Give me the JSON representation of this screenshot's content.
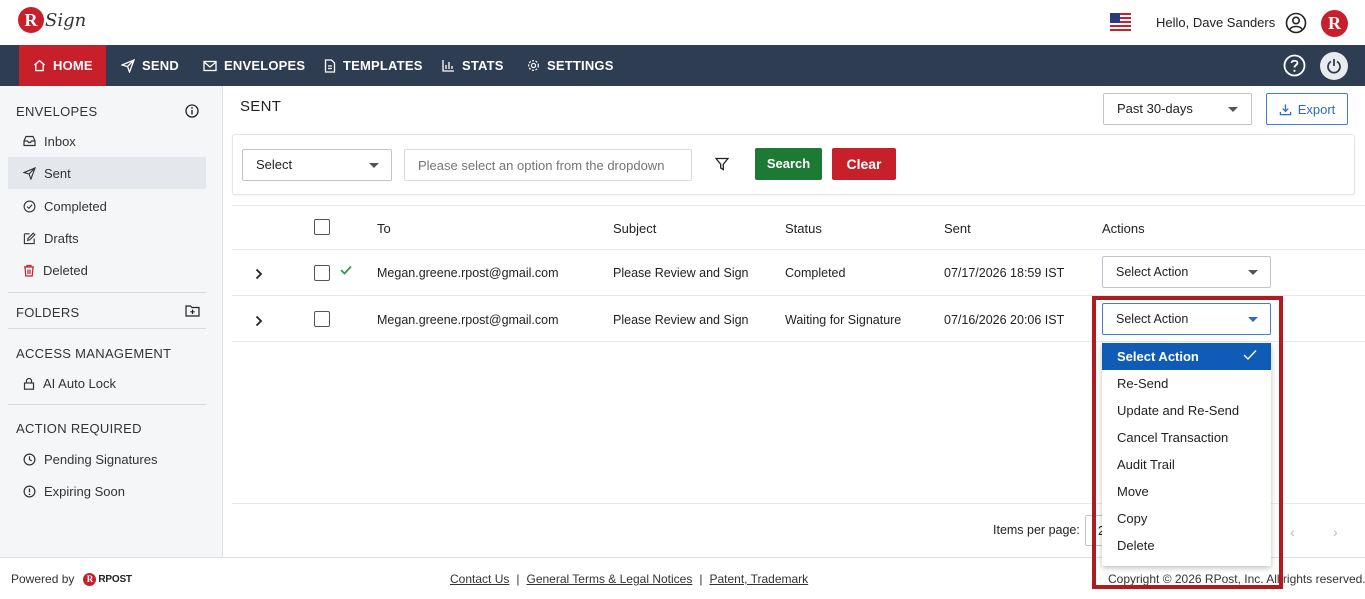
{
  "header": {
    "logo_text": "Sign",
    "brand_letter": "R",
    "greeting": "Hello, Dave Sanders"
  },
  "nav": {
    "items": [
      {
        "label": "HOME",
        "icon": "home-icon"
      },
      {
        "label": "SEND",
        "icon": "send-icon"
      },
      {
        "label": "ENVELOPES",
        "icon": "envelope-icon"
      },
      {
        "label": "TEMPLATES",
        "icon": "document-icon"
      },
      {
        "label": "STATS",
        "icon": "bar-chart-icon"
      },
      {
        "label": "SETTINGS",
        "icon": "gear-icon"
      }
    ],
    "active": "HOME"
  },
  "sidebar": {
    "envelopes_heading": "ENVELOPES",
    "envelope_items": [
      {
        "label": "Inbox",
        "icon": "inbox-icon"
      },
      {
        "label": "Sent",
        "icon": "send-icon"
      },
      {
        "label": "Completed",
        "icon": "check-circle-icon"
      },
      {
        "label": "Drafts",
        "icon": "edit-icon"
      },
      {
        "label": "Deleted",
        "icon": "trash-icon"
      }
    ],
    "active_item": "Sent",
    "folders_heading": "FOLDERS",
    "access_heading": "ACCESS MANAGEMENT",
    "access_items": [
      {
        "label": "AI Auto Lock",
        "icon": "lock-icon"
      }
    ],
    "action_heading": "ACTION REQUIRED",
    "action_items": [
      {
        "label": "Pending Signatures",
        "icon": "clock-icon"
      },
      {
        "label": "Expiring Soon",
        "icon": "alert-circle-icon"
      }
    ]
  },
  "main": {
    "title": "SENT",
    "period_value": "Past 30-days",
    "export_label": "Export",
    "filter": {
      "select_value": "Select",
      "input_placeholder": "Please select an option from the dropdown",
      "search_label": "Search",
      "clear_label": "Clear"
    },
    "table": {
      "columns": [
        "To",
        "Subject",
        "Status",
        "Sent",
        "Actions"
      ],
      "rows": [
        {
          "to": "Megan.greene.rpost@gmail.com",
          "subject": "Please Review and Sign",
          "status": "Completed",
          "sent": "07/17/2026 18:59 IST",
          "action": "Select Action",
          "completed_mark": true
        },
        {
          "to": "Megan.greene.rpost@gmail.com",
          "subject": "Please Review and Sign",
          "status": "Waiting for Signature",
          "sent": "07/16/2026 20:06 IST",
          "action": "Select Action",
          "completed_mark": false
        }
      ]
    },
    "action_dropdown": {
      "options": [
        "Select Action",
        "Re-Send",
        "Update and Re-Send",
        "Cancel Transaction",
        "Audit Trail",
        "Move",
        "Copy",
        "Delete"
      ],
      "selected": "Select Action"
    },
    "pagination": {
      "items_per_page_label": "Items per page:",
      "items_per_page_value": "20"
    }
  },
  "footer": {
    "powered_by": "Powered by",
    "powered_brand": "RPOST",
    "links": [
      "Contact Us",
      "General Terms & Legal Notices",
      "Patent, Trademark"
    ],
    "separator": "|",
    "copyright": "Copyright © 2026 RPost, Inc. All rights reserved."
  },
  "colors": {
    "brand_red": "#c8202a",
    "navbar": "#2f3d52",
    "search_green": "#1c7a34",
    "dropdown_selected_blue": "#0f5bb5",
    "highlight_frame": "#b11b20"
  }
}
